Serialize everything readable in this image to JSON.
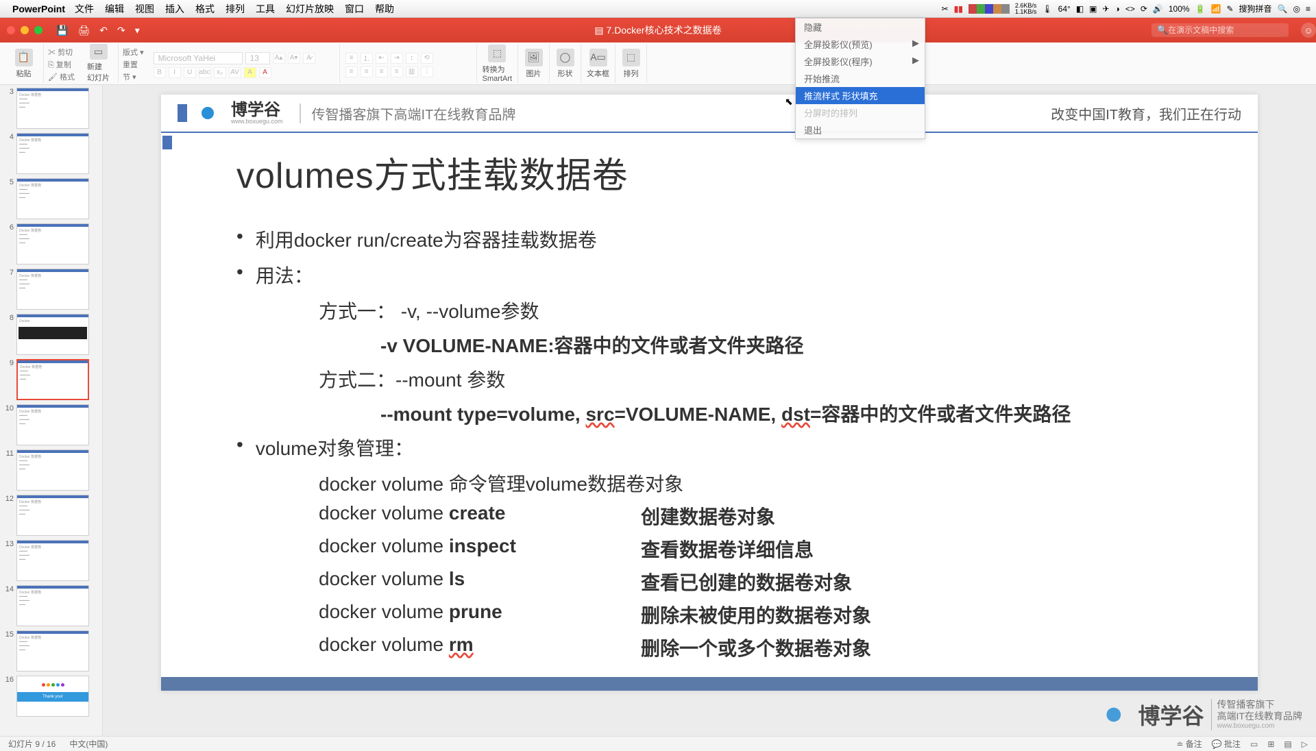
{
  "mac_menu": {
    "app": "PowerPoint",
    "items": [
      "文件",
      "编辑",
      "视图",
      "插入",
      "格式",
      "排列",
      "工具",
      "幻灯片放映",
      "窗口",
      "帮助"
    ]
  },
  "mac_right": {
    "net": "2.6KB/s\n1.1KB/s",
    "temp": "64°",
    "battery": "100%",
    "ime": "搜狗拼音"
  },
  "titlebar": {
    "doc": "7.Docker核心技术之数据卷",
    "search_ph": "在演示文稿中搜索"
  },
  "ribbon": {
    "paste": "粘贴",
    "cut": "剪切",
    "copy": "复制",
    "format": "格式",
    "newslide": "新建\n幻灯片",
    "layout": "版式",
    "reset": "重置",
    "section": "节",
    "font": "Microsoft YaHei",
    "size": "13",
    "convert": "转换为\nSmartArt",
    "picture": "图片",
    "shape": "形状",
    "textbox": "文本框",
    "arrange": "排列"
  },
  "dropdown": {
    "items": [
      {
        "label": "隐藏"
      },
      {
        "label": "全屏投影仪(预览)",
        "arrow": true
      },
      {
        "label": "全屏投影仪(程序)",
        "arrow": true
      },
      {
        "label": "开始推流"
      },
      {
        "label": "推流样式",
        "sel": true,
        "extra": "形状填充"
      },
      {
        "label": "分屏时的排列",
        "disabled": true
      },
      {
        "label": "退出"
      }
    ]
  },
  "thumbs": [
    3,
    4,
    5,
    6,
    7,
    8,
    9,
    10,
    11,
    12,
    13,
    14,
    15,
    16
  ],
  "current_slide": 9,
  "slide": {
    "brand_cn": "博学谷",
    "brand_en": "www.boxuegu.com",
    "slogan1": "传智播客旗下高端IT在线教育品牌",
    "slogan2": "改变中国IT教育，我们正在行动",
    "title": "volumes方式挂载数据卷",
    "b1": "利用docker run/create为容器挂载数据卷",
    "b2": "用法：",
    "m1": "方式一：  -v, --volume参数",
    "m1b": "-v VOLUME-NAME:容器中的文件或者文件夹路径",
    "m2": "方式二：--mount 参数",
    "m2b_pre": "--mount type=volume, ",
    "m2b_src": "src",
    "m2b_mid": "=VOLUME-NAME, ",
    "m2b_dst": "dst",
    "m2b_post": "=容器中的文件或者文件夹路径",
    "b3": "volume对象管理：",
    "mgmt_intro": "docker volume 命令管理volume数据卷对象",
    "cmds": [
      {
        "c": "docker volume ",
        "k": "create",
        "d": "创建数据卷对象"
      },
      {
        "c": "docker volume ",
        "k": "inspect",
        "d": "查看数据卷详细信息"
      },
      {
        "c": "docker volume ",
        "k": "ls",
        "d": "查看已创建的数据卷对象"
      },
      {
        "c": "docker volume ",
        "k": "prune",
        "d": "删除未被使用的数据卷对象"
      },
      {
        "c": "docker volume ",
        "k": "rm",
        "d": "删除一个或多个数据卷对象",
        "und": true
      }
    ]
  },
  "status": {
    "left": "幻灯片 9 / 16",
    "lang": "中文(中国)",
    "notes": "备注",
    "comments": "批注"
  },
  "wm": {
    "brand": "博学谷",
    "l1": "传智播客旗下",
    "l2": "高端IT在线教育品牌",
    "site": "www.boxuegu.com"
  }
}
